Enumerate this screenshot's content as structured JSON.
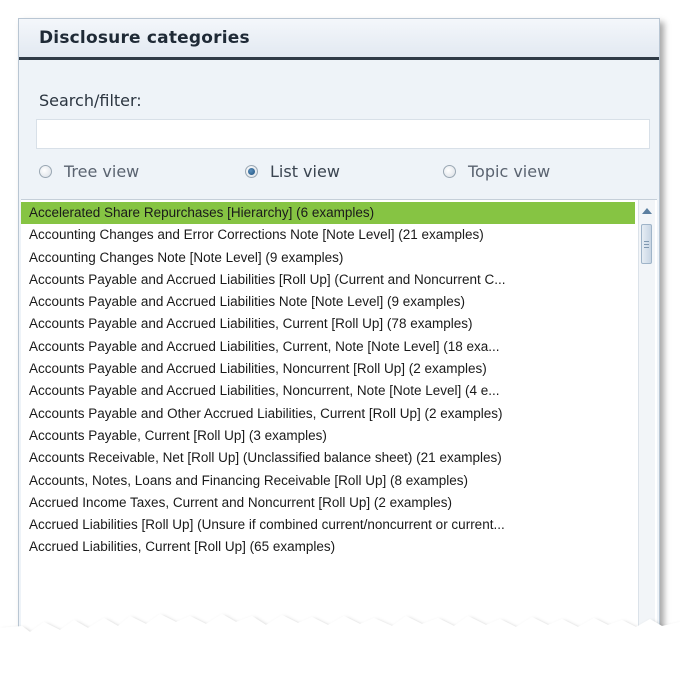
{
  "panel": {
    "title": "Disclosure categories",
    "search": {
      "label": "Search/filter:",
      "value": "",
      "placeholder": ""
    },
    "view_options": [
      {
        "label": "Tree view",
        "selected": false
      },
      {
        "label": "List view",
        "selected": true
      },
      {
        "label": "Topic view",
        "selected": false
      }
    ],
    "list_items": [
      "Accelerated Share Repurchases [Hierarchy] (6 examples)",
      "Accounting Changes and Error Corrections Note [Note Level] (21 examples)",
      "Accounting Changes Note [Note Level] (9 examples)",
      "Accounts Payable and Accrued Liabilities [Roll Up] (Current and Noncurrent C...",
      "Accounts Payable and Accrued Liabilities Note [Note Level] (9 examples)",
      "Accounts Payable and Accrued Liabilities, Current [Roll Up] (78 examples)",
      "Accounts Payable and Accrued Liabilities, Current, Note [Note Level] (18 exa...",
      "Accounts Payable and Accrued Liabilities, Noncurrent [Roll Up] (2 examples)",
      "Accounts Payable and Accrued Liabilities, Noncurrent, Note [Note Level] (4 e...",
      "Accounts Payable and Other Accrued Liabilities, Current [Roll Up] (2 examples)",
      "Accounts Payable, Current [Roll Up] (3 examples)",
      "Accounts Receivable, Net [Roll Up] (Unclassified balance sheet) (21 examples)",
      "Accounts, Notes, Loans and Financing Receivable [Roll Up] (8 examples)",
      "Accrued Income Taxes, Current and Noncurrent [Roll Up] (2 examples)",
      "Accrued Liabilities [Roll Up] (Unsure if combined current/noncurrent or current...",
      "Accrued Liabilities, Current [Roll Up] (65 examples)"
    ],
    "selected_index": 0
  },
  "colors": {
    "selection": "#86c443",
    "header_rule": "#2f3b46",
    "panel_bg": "#eef3f8"
  }
}
